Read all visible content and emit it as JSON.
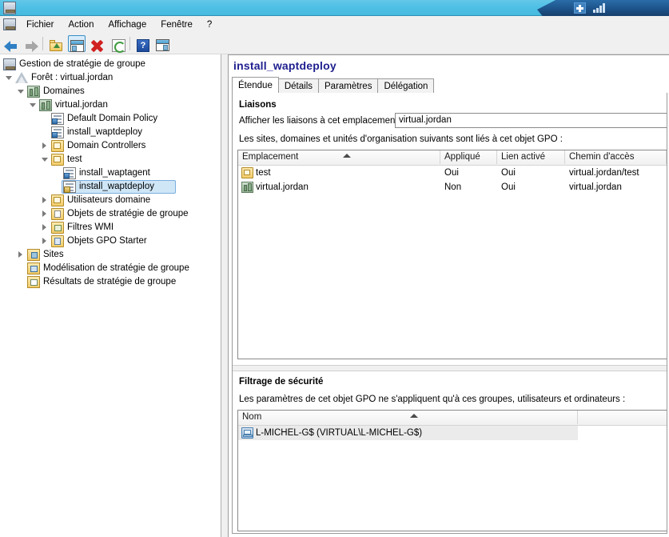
{
  "titlebar": {
    "app_icon": "console-icon",
    "rdp_pin_icon": "pin-icon",
    "rdp_signal_icon": "signal-bars-icon"
  },
  "menubar": {
    "icon": "console-icon",
    "items": [
      {
        "label": "Fichier",
        "name": "menu-fichier"
      },
      {
        "label": "Action",
        "name": "menu-action"
      },
      {
        "label": "Affichage",
        "name": "menu-affichage"
      },
      {
        "label": "Fenêtre",
        "name": "menu-fenetre"
      },
      {
        "label": "?",
        "name": "menu-aide"
      }
    ]
  },
  "toolbar": {
    "buttons": [
      {
        "name": "back-arrow-icon",
        "tip": "Précédent"
      },
      {
        "name": "forward-arrow-icon",
        "tip": "Suivant"
      },
      {
        "name": "up-one-level-icon",
        "tip": "Monter d'un niveau"
      },
      {
        "name": "show-hide-tree-icon",
        "tip": "Afficher/Masquer l'arborescence"
      },
      {
        "name": "delete-icon",
        "tip": "Supprimer"
      },
      {
        "name": "refresh-icon",
        "tip": "Actualiser"
      },
      {
        "name": "help-icon",
        "tip": "Aide",
        "glyph": "?"
      },
      {
        "name": "properties-icon",
        "tip": "Propriétés"
      }
    ]
  },
  "tree": {
    "nodes": [
      {
        "label": "Gestion de stratégie de groupe",
        "depth": 0,
        "icon": "console-icon",
        "expander": "none",
        "selected": false
      },
      {
        "label": "Forêt : virtual.jordan",
        "depth": 1,
        "icon": "forest-icon",
        "expander": "expanded",
        "selected": false
      },
      {
        "label": "Domaines",
        "depth": 2,
        "icon": "domains-icon",
        "expander": "expanded",
        "selected": false
      },
      {
        "label": "virtual.jordan",
        "depth": 3,
        "icon": "domain-icon",
        "expander": "expanded",
        "selected": false
      },
      {
        "label": "Default Domain Policy",
        "depth": 4,
        "icon": "gpo-icon",
        "expander": "none",
        "selected": false
      },
      {
        "label": "install_waptdeploy",
        "depth": 4,
        "icon": "gpo-icon",
        "expander": "none",
        "selected": false
      },
      {
        "label": "Domain Controllers",
        "depth": 4,
        "icon": "ou-icon",
        "expander": "collapsed",
        "selected": false
      },
      {
        "label": "test",
        "depth": 4,
        "icon": "ou-icon",
        "expander": "expanded",
        "selected": false
      },
      {
        "label": "install_waptagent",
        "depth": 5,
        "icon": "gpo-icon",
        "expander": "none",
        "selected": false
      },
      {
        "label": "install_waptdeploy",
        "depth": 5,
        "icon": "gpo-lock-icon",
        "expander": "none",
        "selected": true
      },
      {
        "label": "Utilisateurs domaine",
        "depth": 4,
        "icon": "ou-icon",
        "expander": "collapsed",
        "selected": false
      },
      {
        "label": "Objets de stratégie de groupe",
        "depth": 4,
        "icon": "folder-doc-icon",
        "expander": "collapsed",
        "selected": false
      },
      {
        "label": "Filtres WMI",
        "depth": 4,
        "icon": "folder-wmi-icon",
        "expander": "collapsed",
        "selected": false
      },
      {
        "label": "Objets GPO Starter",
        "depth": 4,
        "icon": "folder-starter-icon",
        "expander": "collapsed",
        "selected": false
      },
      {
        "label": "Sites",
        "depth": 2,
        "icon": "sites-icon",
        "expander": "collapsed",
        "selected": false
      },
      {
        "label": "Modélisation de stratégie de groupe",
        "depth": 2,
        "icon": "modeling-icon",
        "expander": "none",
        "selected": false
      },
      {
        "label": "Résultats de stratégie de groupe",
        "depth": 2,
        "icon": "results-icon",
        "expander": "none",
        "selected": false
      }
    ]
  },
  "details": {
    "title": "install_waptdeploy",
    "tabs": [
      {
        "label": "Étendue",
        "name": "tab-etendue",
        "active": true
      },
      {
        "label": "Détails",
        "name": "tab-details",
        "active": false
      },
      {
        "label": "Paramètres",
        "name": "tab-parametres",
        "active": false
      },
      {
        "label": "Délégation",
        "name": "tab-delegation",
        "active": false
      }
    ],
    "liaisons": {
      "heading": "Liaisons",
      "location_label": "Afficher les liaisons à cet emplacement :",
      "location_value": "virtual.jordan",
      "description": "Les sites, domaines et unités d'organisation suivants sont liés à cet objet GPO :",
      "columns": [
        {
          "label": "Emplacement",
          "name": "col-emplacement",
          "sorted": true
        },
        {
          "label": "Appliqué",
          "name": "col-applique",
          "sorted": false
        },
        {
          "label": "Lien activé",
          "name": "col-lien-active",
          "sorted": false
        },
        {
          "label": "Chemin d'accès",
          "name": "col-chemin",
          "sorted": false
        }
      ],
      "rows": [
        {
          "icon": "ou-icon",
          "emplacement": "test",
          "applique": "Oui",
          "lien_active": "Oui",
          "chemin": "virtual.jordan/test"
        },
        {
          "icon": "domain-icon",
          "emplacement": "virtual.jordan",
          "applique": "Non",
          "lien_active": "Oui",
          "chemin": "virtual.jordan"
        }
      ]
    },
    "filtrage": {
      "heading": "Filtrage de sécurité",
      "description": "Les paramètres de cet objet GPO ne s'appliquent qu'à ces groupes, utilisateurs et ordinateurs :",
      "columns": [
        {
          "label": "Nom",
          "name": "col-nom",
          "sorted": true
        }
      ],
      "rows": [
        {
          "icon": "computer-icon",
          "nom": "L-MICHEL-G$ (VIRTUAL\\L-MICHEL-G$)"
        }
      ]
    }
  },
  "colors": {
    "titlebar": "#4fc0e6",
    "rdp_bar": "#1d538a",
    "panel_title": "#1f1f8f",
    "selection": "#cfe6f7",
    "row_highlight": "#ebebeb"
  }
}
